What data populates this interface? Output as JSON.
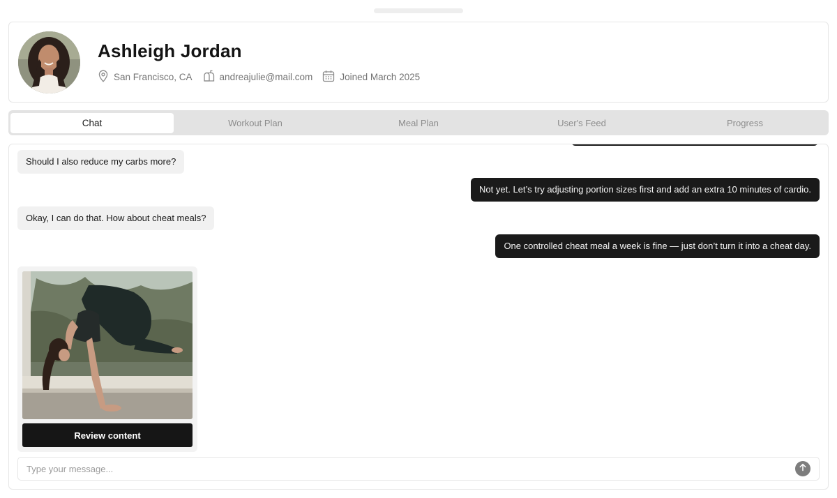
{
  "profile": {
    "name": "Ashleigh Jordan",
    "location": "San Francisco, CA",
    "email": "andreajulie@mail.com",
    "joined": "Joined March 2025",
    "icons": [
      "map-pin-icon",
      "mailbox-icon",
      "calendar-icon"
    ]
  },
  "tabs": [
    {
      "label": "Chat",
      "active": true
    },
    {
      "label": "Workout Plan",
      "active": false
    },
    {
      "label": "Meal Plan",
      "active": false
    },
    {
      "label": "User's Feed",
      "active": false
    },
    {
      "label": "Progress",
      "active": false
    }
  ],
  "messages": [
    {
      "from": "user",
      "text": "Should I also reduce my carbs more?"
    },
    {
      "from": "coach",
      "text": "Not yet. Let’s try adjusting portion sizes first and add an extra 10 minutes of cardio."
    },
    {
      "from": "user",
      "text": "Okay, I can do that. How about cheat meals?"
    },
    {
      "from": "coach",
      "text": "One controlled cheat meal a week is fine — just don’t turn it into a cheat day."
    }
  ],
  "attachment": {
    "button_label": "Review content"
  },
  "composer": {
    "placeholder": "Type your message...",
    "send_icon": "arrow-up-icon"
  },
  "colors": {
    "dark_bubble": "#1a1a1a",
    "light_bubble": "#f1f1f1",
    "tab_bar": "#e3e3e3",
    "send_button": "#7d7d7d"
  }
}
